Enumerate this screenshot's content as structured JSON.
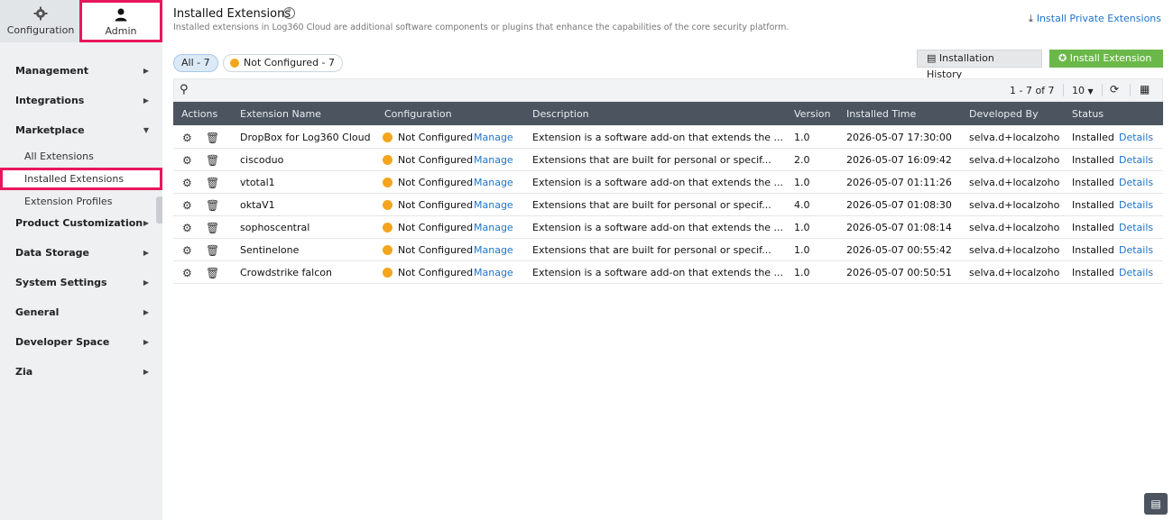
{
  "topnav": {
    "configuration_label": "Configuration",
    "admin_label": "Admin"
  },
  "sidebar": {
    "items": [
      {
        "label": "Management"
      },
      {
        "label": "Integrations"
      },
      {
        "label": "Marketplace"
      },
      {
        "label": "Product Customization"
      },
      {
        "label": "Data Storage"
      },
      {
        "label": "System Settings"
      },
      {
        "label": "General"
      },
      {
        "label": "Developer Space"
      },
      {
        "label": "Zia"
      }
    ],
    "marketplace_sub": [
      {
        "label": "All Extensions"
      },
      {
        "label": "Installed Extensions"
      },
      {
        "label": "Extension Profiles"
      }
    ]
  },
  "header": {
    "title": "Installed Extensions",
    "help": "?",
    "subtitle": "Installed extensions in Log360 Cloud are additional software components or plugins that enhance the capabilities of the core security platform.",
    "private_link": "Install Private Extensions"
  },
  "filters": {
    "all": "All - 7",
    "not_configured": "Not Configured - 7"
  },
  "buttons": {
    "history": "Installation History",
    "install": "Install Extension"
  },
  "toolbar": {
    "pager": "1 - 7 of 7",
    "per_page": "10"
  },
  "table": {
    "headers": {
      "actions": "Actions",
      "name": "Extension Name",
      "configuration": "Configuration",
      "description": "Description",
      "version": "Version",
      "installed_time": "Installed Time",
      "developed_by": "Developed By",
      "status": "Status"
    },
    "rows": [
      {
        "name": "DropBox for Log360 Cloud",
        "config": "Not Configured",
        "manage": "Manage",
        "description": "Extension is a software add-on that extends the ...",
        "version": "1.0",
        "time": "2026-05-07 17:30:00",
        "dev": "selva.d+localzoho",
        "status": "Installed",
        "details": "Details"
      },
      {
        "name": "ciscoduo",
        "config": "Not Configured",
        "manage": "Manage",
        "description": "Extensions that are built for personal or specif...",
        "version": "2.0",
        "time": "2026-05-07 16:09:42",
        "dev": "selva.d+localzoho",
        "status": "Installed",
        "details": "Details"
      },
      {
        "name": "vtotal1",
        "config": "Not Configured",
        "manage": "Manage",
        "description": "Extension is a software add-on that extends the ...",
        "version": "1.0",
        "time": "2026-05-07 01:11:26",
        "dev": "selva.d+localzoho",
        "status": "Installed",
        "details": "Details"
      },
      {
        "name": "oktaV1",
        "config": "Not Configured",
        "manage": "Manage",
        "description": "Extensions that are built for personal or specif...",
        "version": "4.0",
        "time": "2026-05-07 01:08:30",
        "dev": "selva.d+localzoho",
        "status": "Installed",
        "details": "Details"
      },
      {
        "name": "sophoscentral",
        "config": "Not Configured",
        "manage": "Manage",
        "description": "Extension is a software add-on that extends the ...",
        "version": "1.0",
        "time": "2026-05-07 01:08:14",
        "dev": "selva.d+localzoho",
        "status": "Installed",
        "details": "Details"
      },
      {
        "name": "Sentinelone",
        "config": "Not Configured",
        "manage": "Manage",
        "description": "Extensions that are built for personal or specif...",
        "version": "1.0",
        "time": "2026-05-07 00:55:42",
        "dev": "selva.d+localzoho",
        "status": "Installed",
        "details": "Details"
      },
      {
        "name": "Crowdstrike falcon",
        "config": "Not Configured",
        "manage": "Manage",
        "description": "Extension is a software add-on that extends the ...",
        "version": "1.0",
        "time": "2026-05-07 00:50:51",
        "dev": "selva.d+localzoho",
        "status": "Installed",
        "details": "Details"
      }
    ]
  },
  "colors": {
    "accent_highlight": "#e8175d",
    "link": "#1f74c9",
    "install_button": "#6bb84a",
    "status_not_configured": "#f4a51c",
    "table_header": "#4b545f"
  }
}
